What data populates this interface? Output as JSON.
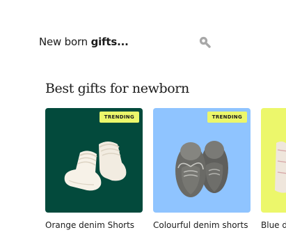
{
  "search": {
    "text_light": "New born",
    "text_bold": "gifts...",
    "icon": "search-icon"
  },
  "section": {
    "title": "Best gifts for newborn"
  },
  "products": [
    {
      "title": "Orange denim Shorts",
      "badge": "TRENDING",
      "bg": "#034a3c",
      "icon": "knit-booties-icon"
    },
    {
      "title": "Colourful denim shorts",
      "badge": "TRENDING",
      "bg": "#8fc4ff",
      "icon": "moccasin-shoes-icon"
    },
    {
      "title": "Blue de",
      "badge": "",
      "bg": "#ecf76b",
      "icon": "fabric-icon"
    }
  ],
  "colors": {
    "badge": "#ecf76b",
    "card_green": "#034a3c",
    "card_blue": "#8fc4ff",
    "card_yellow": "#ecf76b",
    "search_icon": "#a8a8a8"
  }
}
